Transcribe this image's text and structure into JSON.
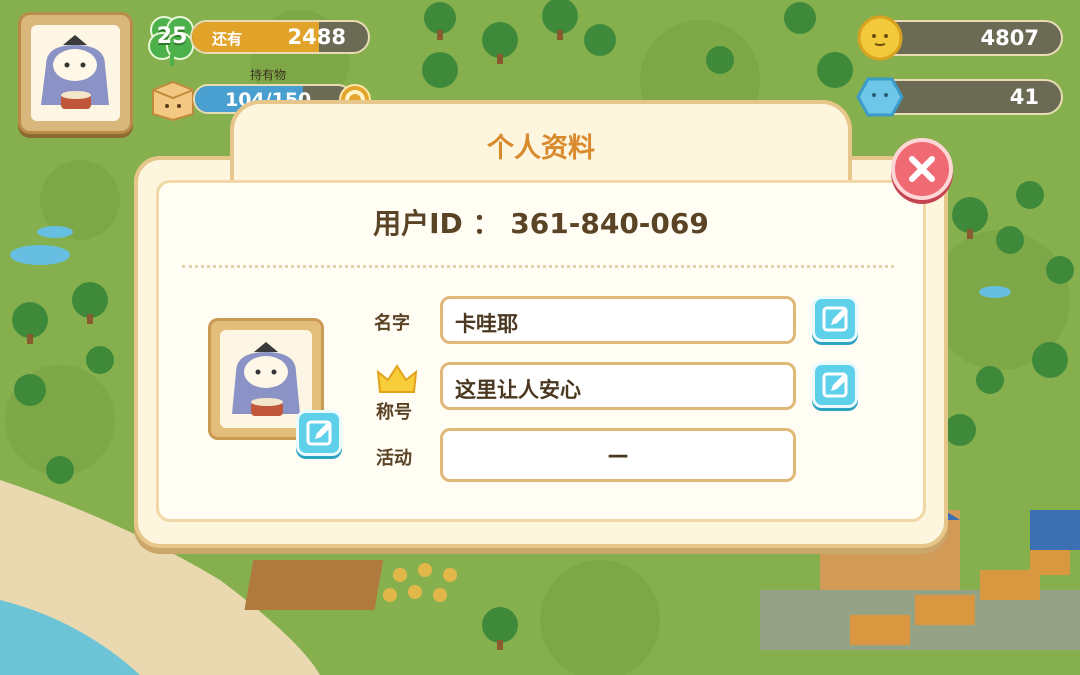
{
  "hud": {
    "level": "25",
    "xp_label": "还有",
    "xp_value": "2488",
    "xp_progress": 0.72,
    "items_caption": "持有物",
    "items_value": "104/150",
    "items_progress": 0.69,
    "coins": "4807",
    "gems": "41",
    "icons": {
      "level": "clover-icon",
      "items": "box-icon",
      "coins": "coin-icon",
      "gems": "gem-icon",
      "items_button": "ring-button-icon"
    }
  },
  "dialog": {
    "title": "个人资料",
    "user_id": "用户ID ： 361-840-069",
    "fields": {
      "name_label": "名字",
      "name_value": "卡哇耶",
      "title_label": "称号",
      "title_value": "这里让人安心",
      "event_label": "活动",
      "event_value": "—"
    },
    "icons": {
      "close": "close-icon",
      "edit": "pencil-edit-icon",
      "crown": "crown-icon"
    }
  },
  "colors": {
    "accent_title": "#d88a2c",
    "close_button": "#f06a74",
    "edit_button": "#5fd0ea",
    "xp_fill": "#e1a32a",
    "items_fill": "#4a9fd1"
  }
}
